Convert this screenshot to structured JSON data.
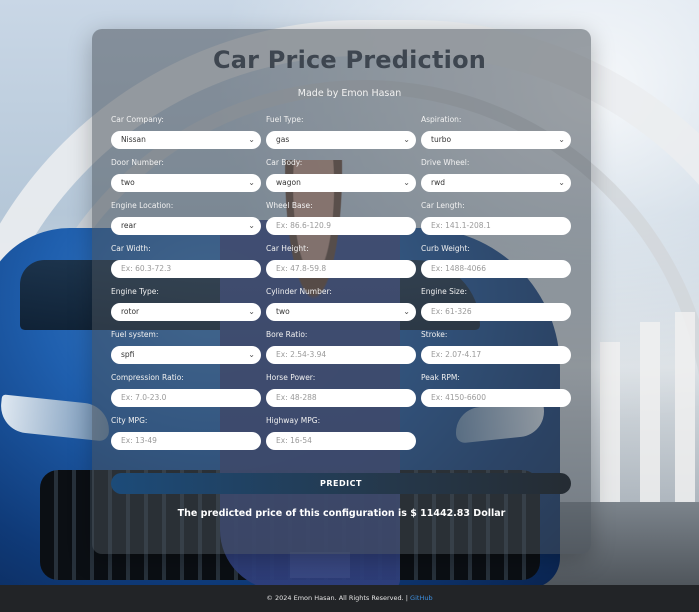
{
  "header": {
    "title": "Car Price Prediction",
    "subtitle": "Made by Emon Hasan"
  },
  "form": {
    "car_company": {
      "label": "Car Company:",
      "value": "Nissan"
    },
    "fuel_type": {
      "label": "Fuel Type:",
      "value": "gas"
    },
    "aspiration": {
      "label": "Aspiration:",
      "value": "turbo"
    },
    "door_number": {
      "label": "Door Number:",
      "value": "two"
    },
    "car_body": {
      "label": "Car Body:",
      "value": "wagon"
    },
    "drive_wheel": {
      "label": "Drive Wheel:",
      "value": "rwd"
    },
    "engine_location": {
      "label": "Engine Location:",
      "value": "rear"
    },
    "wheel_base": {
      "label": "Wheel Base:",
      "placeholder": "Ex: 86.6-120.9"
    },
    "car_length": {
      "label": "Car Length:",
      "placeholder": "Ex: 141.1-208.1"
    },
    "car_width": {
      "label": "Car Width:",
      "placeholder": "Ex: 60.3-72.3"
    },
    "car_height": {
      "label": "Car Height:",
      "placeholder": "Ex: 47.8-59.8"
    },
    "curb_weight": {
      "label": "Curb Weight:",
      "placeholder": "Ex: 1488-4066"
    },
    "engine_type": {
      "label": "Engine Type:",
      "value": "rotor"
    },
    "cylinder_number": {
      "label": "Cylinder Number:",
      "value": "two"
    },
    "engine_size": {
      "label": "Engine Size:",
      "placeholder": "Ex: 61-326"
    },
    "fuel_system": {
      "label": "Fuel system:",
      "value": "spfi"
    },
    "bore_ratio": {
      "label": "Bore Ratio:",
      "placeholder": "Ex: 2.54-3.94"
    },
    "stroke": {
      "label": "Stroke:",
      "placeholder": "Ex: 2.07-4.17"
    },
    "compression_ratio": {
      "label": "Compression Ratio:",
      "placeholder": "Ex: 7.0-23.0"
    },
    "horse_power": {
      "label": "Horse Power:",
      "placeholder": "Ex: 48-288"
    },
    "peak_rpm": {
      "label": "Peak RPM:",
      "placeholder": "Ex: 4150-6600"
    },
    "city_mpg": {
      "label": "City MPG:",
      "placeholder": "Ex: 13-49"
    },
    "highway_mpg": {
      "label": "Highway MPG:",
      "placeholder": "Ex: 16-54"
    }
  },
  "predict_label": "PREDICT",
  "result_text": "The predicted price of this configuration is $ 11442.83 Dollar",
  "footer": {
    "text": "© 2024 Emon Hasan. All Rights Reserved. |",
    "link": "GitHub"
  },
  "colors": {
    "card_bg": "#464e56",
    "button": "#1c4b79",
    "footer_bg": "#222427",
    "link": "#3d8fe0"
  },
  "icons": {
    "select_arrow": "chevron-down-icon"
  }
}
